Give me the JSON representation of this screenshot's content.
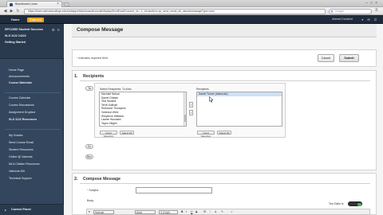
{
  "browser": {
    "tab_title": "Blackboard Learn",
    "url": "https://learn.valenciacollege.edu/webapps/blackboard/execute/displaySendEmail?course_id=_1_1&navItem=cp_send_email_all_users&messageType=user",
    "search_engine": "Google",
    "search_placeholder": "Google"
  },
  "bb_nav": {
    "home": "Home",
    "courses": "Courses",
    "user_name": "Ahmad Dunsfold"
  },
  "sidebar": {
    "course_title": "SPC2350 Student Success",
    "course_code": "SLS 1122 14222",
    "getting_started": "Getting Started",
    "groups": [
      [
        "Home Page",
        "Announcements",
        "Course Materials"
      ],
      [
        "Course Calendar",
        "Course Discussions",
        "Assignment Dropbox",
        "SLS 1122 Resources"
      ],
      [
        "My Grades",
        "Send Course Email",
        "Student Resources",
        "Online @ Valencia",
        "MLA Citation Resources",
        "Valencia ID#",
        "Technical Support"
      ]
    ],
    "control_panel": "Control Panel"
  },
  "page": {
    "title": "Compose Message",
    "required_note": "Indicates required field.",
    "required_star": "*",
    "cancel_label": "Cancel",
    "submit_label": "Submit"
  },
  "recipients": {
    "number": "1.",
    "title": "Recipients",
    "to_label": "To",
    "cc_label": "Cc",
    "bcc_label": "Bcc",
    "available_label": "Select Recipients: To Area",
    "available": [
      "Nachael Nelson",
      "Daniel Ortelan",
      "Test Student",
      "Terrill Sullivan",
      "Ruthanne Thompson",
      "Vanessa Velez",
      "Sheyenne Williams",
      "Lauren Woodard",
      "Taylor Zlegler"
    ],
    "selected_label": "Recipients",
    "selected": [
      "Daniel Turner (Instructor)"
    ],
    "invert_label": "Invert Selection",
    "select_all_label": "Select All",
    "move_right": "›",
    "move_left": "‹"
  },
  "compose": {
    "number": "2.",
    "title": "Compose Message",
    "subject_label": "Subject",
    "body_label": "Body",
    "spell_label": "Text Editor is:",
    "format_label": "Normal",
    "font_label": "Arial",
    "size_label": "3 (12pt)"
  },
  "colors": {
    "accent": "#f6a01a",
    "sidebar": "#33465d",
    "topnav": "#1f2b3a"
  }
}
